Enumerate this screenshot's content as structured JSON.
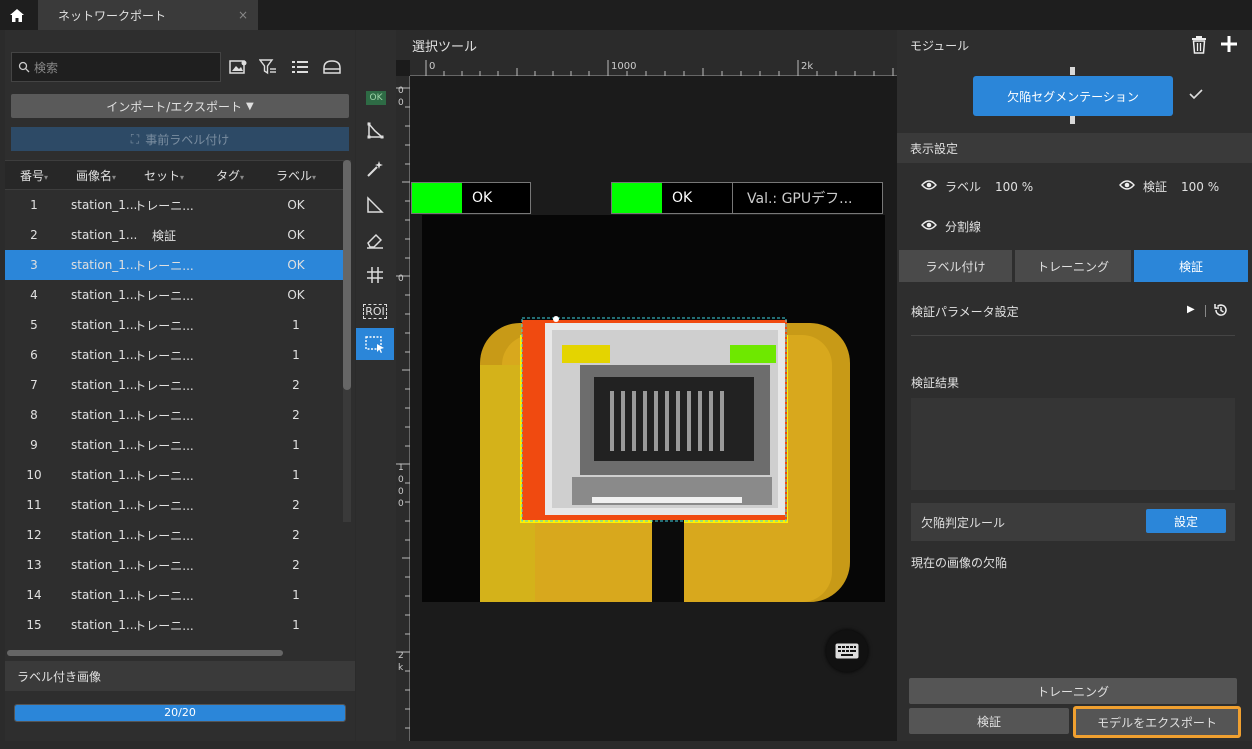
{
  "tabbar": {
    "tab_label": "ネットワークポート",
    "close": "×"
  },
  "left": {
    "search_placeholder": "検索",
    "import_export": "インポート/エクスポート",
    "prelabel": "事前ラベル付け",
    "columns": [
      "番号",
      "画像名",
      "セット",
      "タグ",
      "ラベル"
    ],
    "rows": [
      {
        "no": "1",
        "name": "station_1...",
        "set": "トレーニ...",
        "tag": "",
        "label": "OK"
      },
      {
        "no": "2",
        "name": "station_1...",
        "set": "検証",
        "tag": "",
        "label": "OK"
      },
      {
        "no": "3",
        "name": "station_1...",
        "set": "トレーニ...",
        "tag": "",
        "label": "OK"
      },
      {
        "no": "4",
        "name": "station_1...",
        "set": "トレーニ...",
        "tag": "",
        "label": "OK"
      },
      {
        "no": "5",
        "name": "station_1...",
        "set": "トレーニ...",
        "tag": "",
        "label": "1"
      },
      {
        "no": "6",
        "name": "station_1...",
        "set": "トレーニ...",
        "tag": "",
        "label": "1"
      },
      {
        "no": "7",
        "name": "station_1...",
        "set": "トレーニ...",
        "tag": "",
        "label": "2"
      },
      {
        "no": "8",
        "name": "station_1...",
        "set": "トレーニ...",
        "tag": "",
        "label": "2"
      },
      {
        "no": "9",
        "name": "station_1...",
        "set": "トレーニ...",
        "tag": "",
        "label": "1"
      },
      {
        "no": "10",
        "name": "station_1...",
        "set": "トレーニ...",
        "tag": "",
        "label": "1"
      },
      {
        "no": "11",
        "name": "station_1...",
        "set": "トレーニ...",
        "tag": "",
        "label": "2"
      },
      {
        "no": "12",
        "name": "station_1...",
        "set": "トレーニ...",
        "tag": "",
        "label": "2"
      },
      {
        "no": "13",
        "name": "station_1...",
        "set": "トレーニ...",
        "tag": "",
        "label": "2"
      },
      {
        "no": "14",
        "name": "station_1...",
        "set": "トレーニ...",
        "tag": "",
        "label": "1"
      },
      {
        "no": "15",
        "name": "station_1...",
        "set": "トレーニ...",
        "tag": "",
        "label": "1"
      }
    ],
    "selected_row": 3,
    "labeled_images_title": "ラベル付き画像",
    "progress_text": "20/20",
    "progress_fraction": 1.0
  },
  "toolbar": {
    "ok_badge": "OK",
    "roi_label": "ROI"
  },
  "canvas": {
    "title": "選択ツール",
    "ruler_top": [
      "0",
      "1000",
      "2k"
    ],
    "ruler_left": [
      "0",
      "0",
      "0",
      "1000",
      "2k"
    ],
    "ok_left": "OK",
    "ok_right": "OK",
    "val_text": "Val.:  GPUデフ..."
  },
  "right": {
    "module_title": "モジュール",
    "module_node": "欠陥セグメンテーション",
    "display_settings": "表示設定",
    "label_toggle": "ラベル",
    "label_pct": "100 %",
    "verify_toggle": "検証",
    "verify_pct": "100 %",
    "split_line": "分割線",
    "tabs": [
      "ラベル付け",
      "トレーニング",
      "検証"
    ],
    "active_tab": "検証",
    "verify_params": "検証パラメータ設定",
    "verify_result": "検証結果",
    "defect_rule": "欠陥判定ルール",
    "settings_btn": "設定",
    "current_defects": "現在の画像の欠陥",
    "train_btn": "トレーニング",
    "verify_btn": "検証",
    "export_btn": "モデルをエクスポート"
  },
  "colors": {
    "accent": "#2b86d9",
    "ok_green": "#00ff00",
    "export_border": "#f0a030"
  }
}
